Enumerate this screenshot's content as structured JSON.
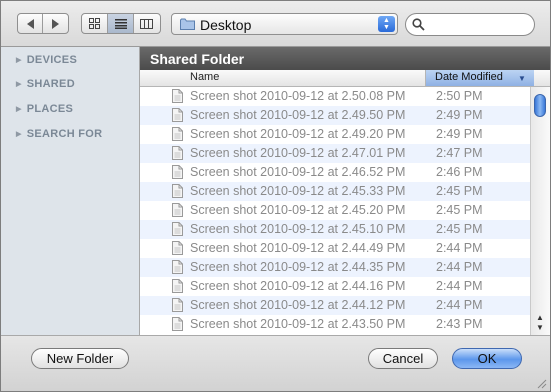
{
  "toolbar": {
    "back_icon": "back-arrow-icon",
    "forward_icon": "forward-arrow-icon",
    "views": [
      "icon-view-icon",
      "list-view-icon",
      "column-view-icon"
    ],
    "active_view": "list",
    "location": "Desktop",
    "search_placeholder": ""
  },
  "sidebar": {
    "items": [
      {
        "label": "DEVICES"
      },
      {
        "label": "SHARED"
      },
      {
        "label": "PLACES"
      },
      {
        "label": "SEARCH FOR"
      }
    ]
  },
  "main": {
    "folder_title": "Shared Folder",
    "columns": {
      "name": "Name",
      "date": "Date Modified"
    },
    "files": [
      {
        "name": "Screen shot 2010-09-12 at 2.50.08 PM",
        "date": "2:50 PM"
      },
      {
        "name": "Screen shot 2010-09-12 at 2.49.50 PM",
        "date": "2:49 PM"
      },
      {
        "name": "Screen shot 2010-09-12 at 2.49.20 PM",
        "date": "2:49 PM"
      },
      {
        "name": "Screen shot 2010-09-12 at 2.47.01 PM",
        "date": "2:47 PM"
      },
      {
        "name": "Screen shot 2010-09-12 at 2.46.52 PM",
        "date": "2:46 PM"
      },
      {
        "name": "Screen shot 2010-09-12 at 2.45.33 PM",
        "date": "2:45 PM"
      },
      {
        "name": "Screen shot 2010-09-12 at 2.45.20 PM",
        "date": "2:45 PM"
      },
      {
        "name": "Screen shot 2010-09-12 at 2.45.10 PM",
        "date": "2:45 PM"
      },
      {
        "name": "Screen shot 2010-09-12 at 2.44.49 PM",
        "date": "2:44 PM"
      },
      {
        "name": "Screen shot 2010-09-12 at 2.44.35 PM",
        "date": "2:44 PM"
      },
      {
        "name": "Screen shot 2010-09-12 at 2.44.16 PM",
        "date": "2:44 PM"
      },
      {
        "name": "Screen shot 2010-09-12 at 2.44.12 PM",
        "date": "2:44 PM"
      },
      {
        "name": "Screen shot 2010-09-12 at 2.43.50 PM",
        "date": "2:43 PM"
      }
    ]
  },
  "buttons": {
    "new_folder": "New Folder",
    "cancel": "Cancel",
    "ok": "OK"
  },
  "colors": {
    "accent": "#5c97ec",
    "row_alt": "#edf3fe",
    "sort_header": "#a7c3ec"
  }
}
